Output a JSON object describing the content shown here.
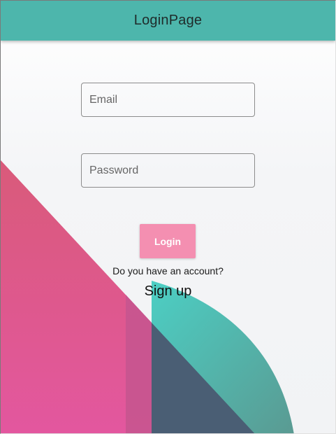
{
  "appbar": {
    "title": "LoginPage"
  },
  "form": {
    "email_placeholder": "Email",
    "password_placeholder": "Password",
    "login_label": "Login"
  },
  "footer": {
    "account_question": "Do you have an account?",
    "signup_label": "Sign up"
  },
  "colors": {
    "appbar": "#4db6ac",
    "login_button": "#f48fb1",
    "decor_pink": "#e0589a",
    "decor_teal": "#4db6ac"
  }
}
